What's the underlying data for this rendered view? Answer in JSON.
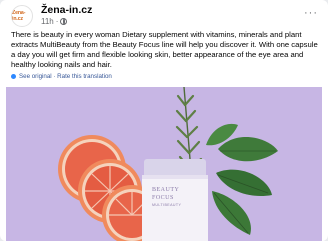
{
  "post": {
    "page_name": "Žena-in.cz",
    "timestamp": "11h",
    "avatar_text": "Žena-in.cz",
    "body": "There is beauty in every woman Dietary supplement with vitamins, minerals and plant extracts MultiBeauty from the Beauty Focus line will help you discover it. With one capsule a day you will get firm and flexible looking skin, better appearance of the eye area and healthy looking nails and hair.",
    "translation_links": "See original · Rate this translation"
  },
  "product": {
    "brand_line1": "BEAUTY",
    "brand_line2": "FOCUS",
    "name": "MULTIBEAUTY"
  },
  "colors": {
    "background": "#c7b6e4",
    "link": "#385898",
    "grapefruit": "#e8654a"
  },
  "icons": {
    "privacy": "globe-icon",
    "menu": "more-icon"
  }
}
